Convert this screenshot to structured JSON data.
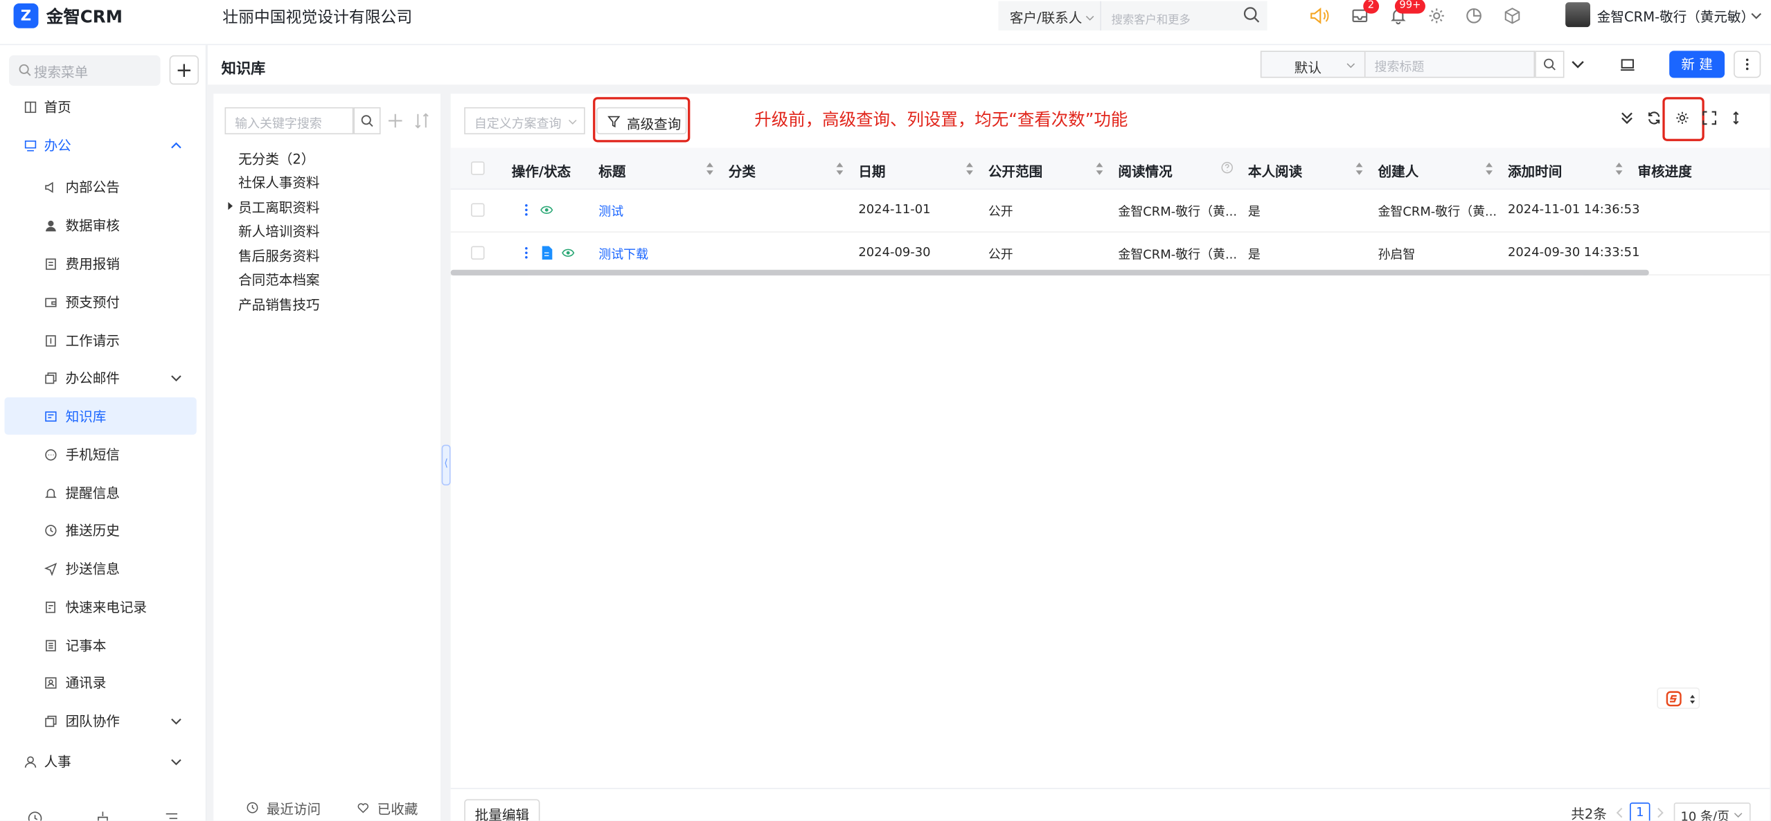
{
  "app": {
    "logo": "Z",
    "brand": "金智CRM",
    "company": "壮丽中国视觉设计有限公司"
  },
  "topbar": {
    "scope": "客户/联系人",
    "search_placeholder": "搜索客户和更多",
    "mail_badge": "2",
    "notify_badge": "99+",
    "user": "金智CRM-敬行（黄元敏）"
  },
  "sidebar": {
    "search_placeholder": "搜索菜单",
    "add": "+",
    "items": [
      {
        "label": "首页",
        "icon": "home-icon"
      },
      {
        "label": "办公",
        "icon": "office-icon"
      },
      {
        "label": "内部公告",
        "icon": "megaphone-icon"
      },
      {
        "label": "数据审核",
        "icon": "user-icon"
      },
      {
        "label": "费用报销",
        "icon": "receipt-icon"
      },
      {
        "label": "预支预付",
        "icon": "wallet-icon"
      },
      {
        "label": "工作请示",
        "icon": "document-icon"
      },
      {
        "label": "办公邮件",
        "icon": "mail-icon"
      },
      {
        "label": "知识库",
        "icon": "book-icon"
      },
      {
        "label": "手机短信",
        "icon": "chat-icon"
      },
      {
        "label": "提醒信息",
        "icon": "bell-icon"
      },
      {
        "label": "推送历史",
        "icon": "clock-icon"
      },
      {
        "label": "抄送信息",
        "icon": "send-icon"
      },
      {
        "label": "快速来电记录",
        "icon": "phone-log-icon"
      },
      {
        "label": "记事本",
        "icon": "notebook-icon"
      },
      {
        "label": "通讯录",
        "icon": "contacts-icon"
      },
      {
        "label": "团队协作",
        "icon": "team-icon"
      },
      {
        "label": "人事",
        "icon": "person-icon"
      }
    ]
  },
  "header": {
    "title": "知识库",
    "view": "默认",
    "search_placeholder": "搜索标题",
    "new_label": "新 建"
  },
  "tree": {
    "search_placeholder": "输入关键字搜索",
    "items": [
      "无分类（2）",
      "社保人事资料",
      "员工离职资料",
      "新人培训资料",
      "售后服务资料",
      "合同范本档案",
      "产品销售技巧"
    ],
    "recent": "最近访问",
    "favorites": "已收藏"
  },
  "grid": {
    "scheme_placeholder": "自定义方案查询",
    "advanced_label": "高级查询",
    "annotation": "升级前，高级查询、列设置，均无“查看次数”功能",
    "columns": [
      "操作/状态",
      "标题",
      "分类",
      "日期",
      "公开范围",
      "阅读情况",
      "本人阅读",
      "创建人",
      "添加时间",
      "审核进度"
    ],
    "rows": [
      {
        "title": "测试",
        "category": "",
        "date": "2024-11-01",
        "scope": "公开",
        "reads": "金智CRM-敬行（黄...",
        "self_read": "是",
        "creator": "金智CRM-敬行（黄...",
        "added": "2024-11-01 14:36:53",
        "progress": ""
      },
      {
        "title": "测试下载",
        "category": "",
        "date": "2024-09-30",
        "scope": "公开",
        "reads": "金智CRM-敬行（黄...",
        "self_read": "是",
        "creator": "孙启智",
        "added": "2024-09-30 14:33:51",
        "progress": ""
      }
    ],
    "batch_label": "批量编辑",
    "total": "共2条",
    "page": "1",
    "page_size": "10 条/页"
  },
  "colors": {
    "accent": "#1b66ff",
    "annotation": "#e1251b",
    "badge": "#f5222d"
  }
}
